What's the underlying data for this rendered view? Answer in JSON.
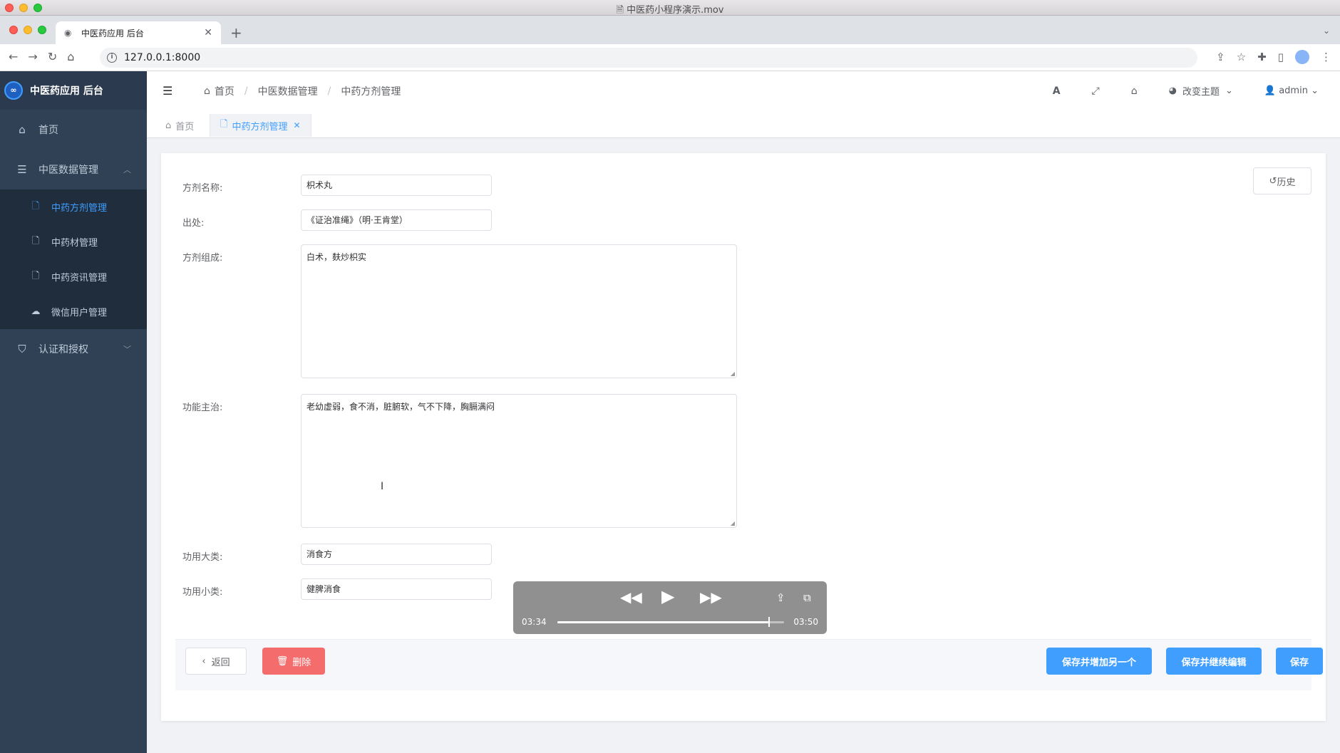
{
  "window": {
    "title": "中医药小程序演示.mov"
  },
  "browser": {
    "tab_title": "中医药应用 后台",
    "url": "127.0.0.1:8000"
  },
  "sidebar": {
    "logo_text": "中医药应用 后台",
    "items": [
      {
        "label": "首页",
        "icon": "home-icon"
      },
      {
        "label": "中医数据管理",
        "icon": "database-icon"
      },
      {
        "label": "认证和授权",
        "icon": "shield-icon"
      }
    ],
    "sub_items": [
      {
        "label": "中药方剂管理",
        "icon": "document-icon",
        "active": true
      },
      {
        "label": "中药材管理",
        "icon": "document-icon"
      },
      {
        "label": "中药资讯管理",
        "icon": "document-icon"
      },
      {
        "label": "微信用户管理",
        "icon": "wechat-icon"
      }
    ]
  },
  "navbar": {
    "breadcrumb": [
      "首页",
      "中医数据管理",
      "中药方剂管理"
    ],
    "theme_label": "改变主题",
    "user_label": "admin"
  },
  "tags": {
    "home": "首页",
    "active": "中药方剂管理"
  },
  "form": {
    "history_label": "历史",
    "name": {
      "label": "方剂名称:",
      "value": "枳术丸"
    },
    "source": {
      "label": "出处:",
      "value": "《证治准绳》（明·王肯堂）"
    },
    "composition": {
      "label": "方剂组成:",
      "value": "白术，麸炒枳实"
    },
    "function": {
      "label": "功能主治:",
      "value": "老幼虚弱，食不消，脏腑软，气不下降，胸膈满闷"
    },
    "category": {
      "label": "功用大类:",
      "value": "消食方"
    },
    "subcategory": {
      "label": "功用小类:",
      "value": "健脾消食"
    }
  },
  "actions": {
    "back": "返回",
    "delete": "删除",
    "save_add": "保存并增加另一个",
    "save_continue": "保存并继续编辑",
    "save": "保存"
  },
  "player": {
    "current_time": "03:34",
    "total_time": "03:50",
    "progress": 0.931
  },
  "colors": {
    "sidebar_bg": "#304156",
    "accent": "#409eff",
    "danger": "#f56c6c"
  }
}
